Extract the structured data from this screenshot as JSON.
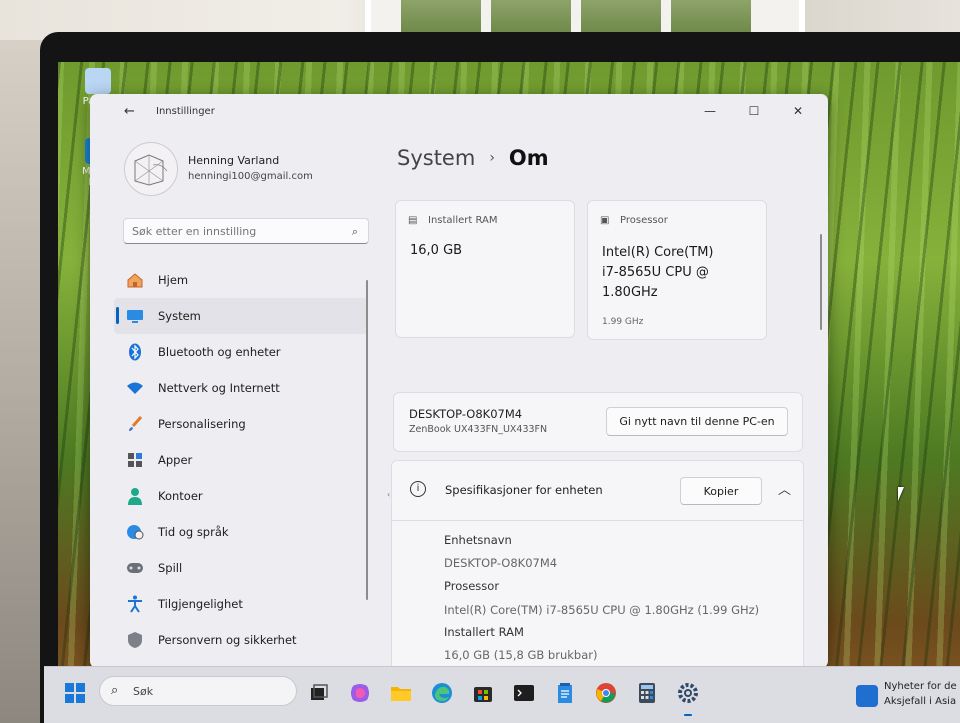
{
  "desktop": {
    "icons": [
      {
        "label": "Papirk"
      },
      {
        "label": "Micros Edg"
      }
    ]
  },
  "window": {
    "title": "Innstillinger",
    "controls": {
      "minimize": "—",
      "maximize": "☐",
      "close": "✕"
    }
  },
  "profile": {
    "name": "Henning Varland",
    "email": "henningi100@gmail.com"
  },
  "search": {
    "placeholder": "Søk etter en innstilling",
    "icon": "search-icon"
  },
  "sidebar": {
    "items": [
      {
        "label": "Hjem",
        "icon": "home-icon",
        "active": false
      },
      {
        "label": "System",
        "icon": "system-icon",
        "active": true
      },
      {
        "label": "Bluetooth og enheter",
        "icon": "bluetooth-icon",
        "active": false
      },
      {
        "label": "Nettverk og Internett",
        "icon": "wifi-icon",
        "active": false
      },
      {
        "label": "Personalisering",
        "icon": "brush-icon",
        "active": false
      },
      {
        "label": "Apper",
        "icon": "apps-icon",
        "active": false
      },
      {
        "label": "Kontoer",
        "icon": "account-icon",
        "active": false
      },
      {
        "label": "Tid og språk",
        "icon": "globe-clock-icon",
        "active": false
      },
      {
        "label": "Spill",
        "icon": "gamepad-icon",
        "active": false
      },
      {
        "label": "Tilgjengelighet",
        "icon": "accessibility-icon",
        "active": false
      },
      {
        "label": "Personvern og sikkerhet",
        "icon": "shield-icon",
        "active": false
      }
    ]
  },
  "breadcrumb": {
    "parent": "System",
    "separator": "›",
    "current": "Om"
  },
  "cards": {
    "ram": {
      "label": "Installert RAM",
      "value": "16,0 GB"
    },
    "processor": {
      "label": "Prosessor",
      "value_lines": [
        "Intel(R) Core(TM)",
        "i7-8565U CPU @",
        "1.80GHz"
      ],
      "sub": "1.99 GHz"
    }
  },
  "pc": {
    "name": "DESKTOP-O8K07M4",
    "model": "ZenBook UX433FN_UX433FN",
    "rename_button": "Gi nytt navn til denne PC-en"
  },
  "specs": {
    "title": "Spesifikasjoner for enheten",
    "copy_button": "Kopier",
    "rows": [
      {
        "key": "Enhetsnavn",
        "value": "DESKTOP-O8K07M4"
      },
      {
        "key": "Prosessor",
        "value": "Intel(R) Core(TM) i7-8565U CPU @ 1.80GHz (1.99 GHz)"
      },
      {
        "key": "Installert RAM",
        "value": "16,0 GB (15,8 GB brukbar)"
      }
    ]
  },
  "taskbar": {
    "search_label": "Søk",
    "apps": [
      "start-icon",
      "task-view-icon",
      "copilot-icon",
      "file-explorer-icon",
      "edge-icon",
      "store-icon",
      "terminal-icon",
      "notepad-icon",
      "chrome-icon",
      "calculator-icon",
      "settings-icon"
    ],
    "news_line1": "Nyheter for de",
    "news_line2": "Aksjefall i Asia"
  },
  "colors": {
    "accent": "#0064c4",
    "window_bg": "#eeeef2",
    "card_bg": "#f6f6f9"
  }
}
